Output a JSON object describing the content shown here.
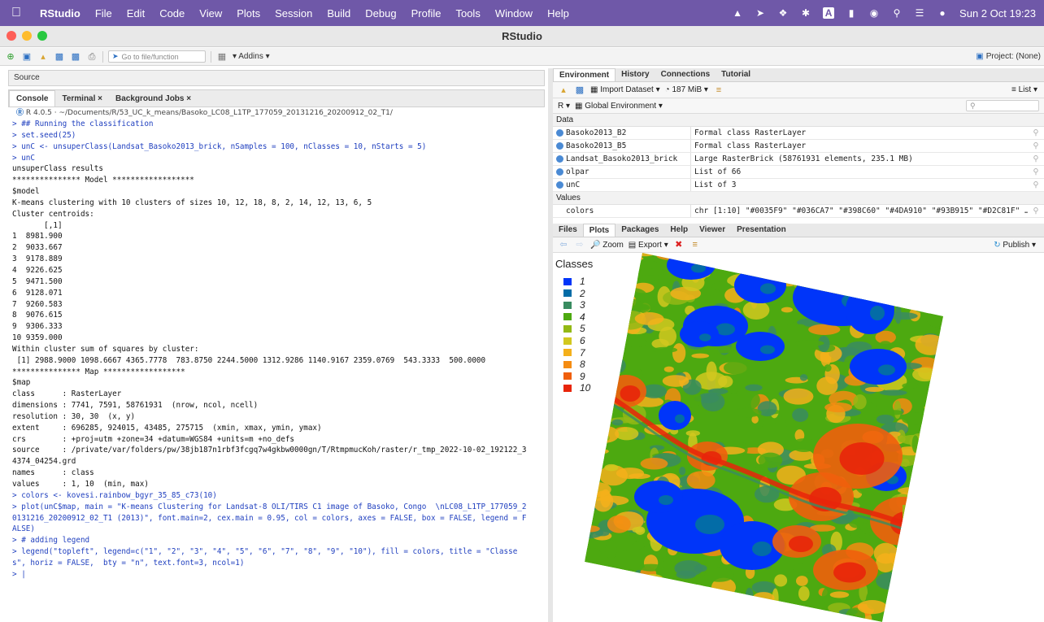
{
  "menubar": {
    "apple": "",
    "app": "RStudio",
    "items": [
      "File",
      "Edit",
      "Code",
      "View",
      "Plots",
      "Session",
      "Build",
      "Debug",
      "Profile",
      "Tools",
      "Window",
      "Help"
    ],
    "clock": "Sun 2 Oct  19:23",
    "accent": "#6f58a8"
  },
  "window": {
    "title": "RStudio"
  },
  "toolbar": {
    "goto_placeholder": "Go to file/function",
    "addins": "Addins",
    "project": "Project: (None)"
  },
  "source": {
    "label": "Source"
  },
  "console": {
    "tabs": [
      "Console",
      "Terminal",
      "Background Jobs"
    ],
    "path": "R 4.0.5 · ~/Documents/R/53_UC_k_means/Basoko_LC08_L1TP_177059_20131216_20200912_02_T1/",
    "lines": [
      {
        "t": "in",
        "s": "> ## Running the classification"
      },
      {
        "t": "in",
        "s": "> set.seed(25)"
      },
      {
        "t": "in",
        "s": "> unC <- unsuperClass(Landsat_Basoko2013_brick, nSamples = 100, nClasses = 10, nStarts = 5)"
      },
      {
        "t": "in",
        "s": "> unC"
      },
      {
        "t": "out",
        "s": "unsuperClass results"
      },
      {
        "t": "out",
        "s": ""
      },
      {
        "t": "out",
        "s": "*************** Model ******************"
      },
      {
        "t": "out",
        "s": "$model"
      },
      {
        "t": "out",
        "s": "K-means clustering with 10 clusters of sizes 10, 12, 18, 8, 2, 14, 12, 13, 6, 5"
      },
      {
        "t": "out",
        "s": ""
      },
      {
        "t": "out",
        "s": "Cluster centroids:"
      },
      {
        "t": "out",
        "s": "       [,1]"
      },
      {
        "t": "out",
        "s": "1  8981.900"
      },
      {
        "t": "out",
        "s": "2  9033.667"
      },
      {
        "t": "out",
        "s": "3  9178.889"
      },
      {
        "t": "out",
        "s": "4  9226.625"
      },
      {
        "t": "out",
        "s": "5  9471.500"
      },
      {
        "t": "out",
        "s": "6  9128.071"
      },
      {
        "t": "out",
        "s": "7  9260.583"
      },
      {
        "t": "out",
        "s": "8  9076.615"
      },
      {
        "t": "out",
        "s": "9  9306.333"
      },
      {
        "t": "out",
        "s": "10 9359.000"
      },
      {
        "t": "out",
        "s": ""
      },
      {
        "t": "out",
        "s": "Within cluster sum of squares by cluster:"
      },
      {
        "t": "out",
        "s": " [1] 2988.9000 1098.6667 4365.7778  783.8750 2244.5000 1312.9286 1140.9167 2359.0769  543.3333  500.0000"
      },
      {
        "t": "out",
        "s": ""
      },
      {
        "t": "out",
        "s": "*************** Map ******************"
      },
      {
        "t": "out",
        "s": "$map"
      },
      {
        "t": "out",
        "s": "class      : RasterLayer"
      },
      {
        "t": "out",
        "s": "dimensions : 7741, 7591, 58761931  (nrow, ncol, ncell)"
      },
      {
        "t": "out",
        "s": "resolution : 30, 30  (x, y)"
      },
      {
        "t": "out",
        "s": "extent     : 696285, 924015, 43485, 275715  (xmin, xmax, ymin, ymax)"
      },
      {
        "t": "out",
        "s": "crs        : +proj=utm +zone=34 +datum=WGS84 +units=m +no_defs"
      },
      {
        "t": "out",
        "s": "source     : /private/var/folders/pw/38jb187n1rbf3fcgq7w4gkbw0000gn/T/RtmpmucKoh/raster/r_tmp_2022-10-02_192122_3"
      },
      {
        "t": "out",
        "s": "4374_04254.grd"
      },
      {
        "t": "out",
        "s": "names      : class"
      },
      {
        "t": "out",
        "s": "values     : 1, 10  (min, max)"
      },
      {
        "t": "out",
        "s": ""
      },
      {
        "t": "in",
        "s": "> colors <- kovesi.rainbow_bgyr_35_85_c73(10)"
      },
      {
        "t": "in",
        "s": "> plot(unC$map, main = \"K-means Clustering for Landsat-8 OLI/TIRS C1 image of Basoko, Congo  \\nLC08_L1TP_177059_2"
      },
      {
        "t": "in",
        "s": "0131216_20200912_02_T1 (2013)\", font.main=2, cex.main = 0.95, col = colors, axes = FALSE, box = FALSE, legend = F"
      },
      {
        "t": "in",
        "s": "ALSE)"
      },
      {
        "t": "in",
        "s": "> # adding legend"
      },
      {
        "t": "in",
        "s": "> legend(\"topleft\", legend=c(\"1\", \"2\", \"3\", \"4\", \"5\", \"6\", \"7\", \"8\", \"9\", \"10\"), fill = colors, title = \"Classe"
      },
      {
        "t": "in",
        "s": "s\", horiz = FALSE,  bty = \"n\", text.font=3, ncol=1)"
      },
      {
        "t": "in",
        "s": "> |"
      }
    ]
  },
  "environment": {
    "tabs": [
      "Environment",
      "History",
      "Connections",
      "Tutorial"
    ],
    "import": "Import Dataset",
    "memory": "187 MiB",
    "lang": "R",
    "scope": "Global Environment",
    "view": "List",
    "data_label": "Data",
    "data": [
      {
        "name": "Basoko2013_B2",
        "value": "Formal class  RasterLayer"
      },
      {
        "name": "Basoko2013_B5",
        "value": "Formal class  RasterLayer"
      },
      {
        "name": "Landsat_Basoko2013_brick",
        "value": "Large RasterBrick (58761931 elements,  235.1 MB)"
      },
      {
        "name": "olpar",
        "value": "List of  66"
      },
      {
        "name": "unC",
        "value": "List of  3"
      }
    ],
    "values_label": "Values",
    "values": [
      {
        "name": "colors",
        "value": "chr [1:10] \"#0035F9\" \"#036CA7\" \"#398C60\" \"#4DA910\" \"#93B915\" \"#D2C81F\" …"
      }
    ]
  },
  "plots": {
    "tabs": [
      "Files",
      "Plots",
      "Packages",
      "Help",
      "Viewer",
      "Presentation"
    ],
    "zoom": "Zoom",
    "export": "Export",
    "publish": "Publish",
    "legend_title": "Classes",
    "legend_labels": [
      "1",
      "2",
      "3",
      "4",
      "5",
      "6",
      "7",
      "8",
      "9",
      "10"
    ],
    "legend_colors": [
      "#0035F9",
      "#036CA7",
      "#398C60",
      "#4DA910",
      "#93B915",
      "#D2C81F",
      "#F4B01B",
      "#F58C12",
      "#F05F0C",
      "#E8250A"
    ]
  }
}
